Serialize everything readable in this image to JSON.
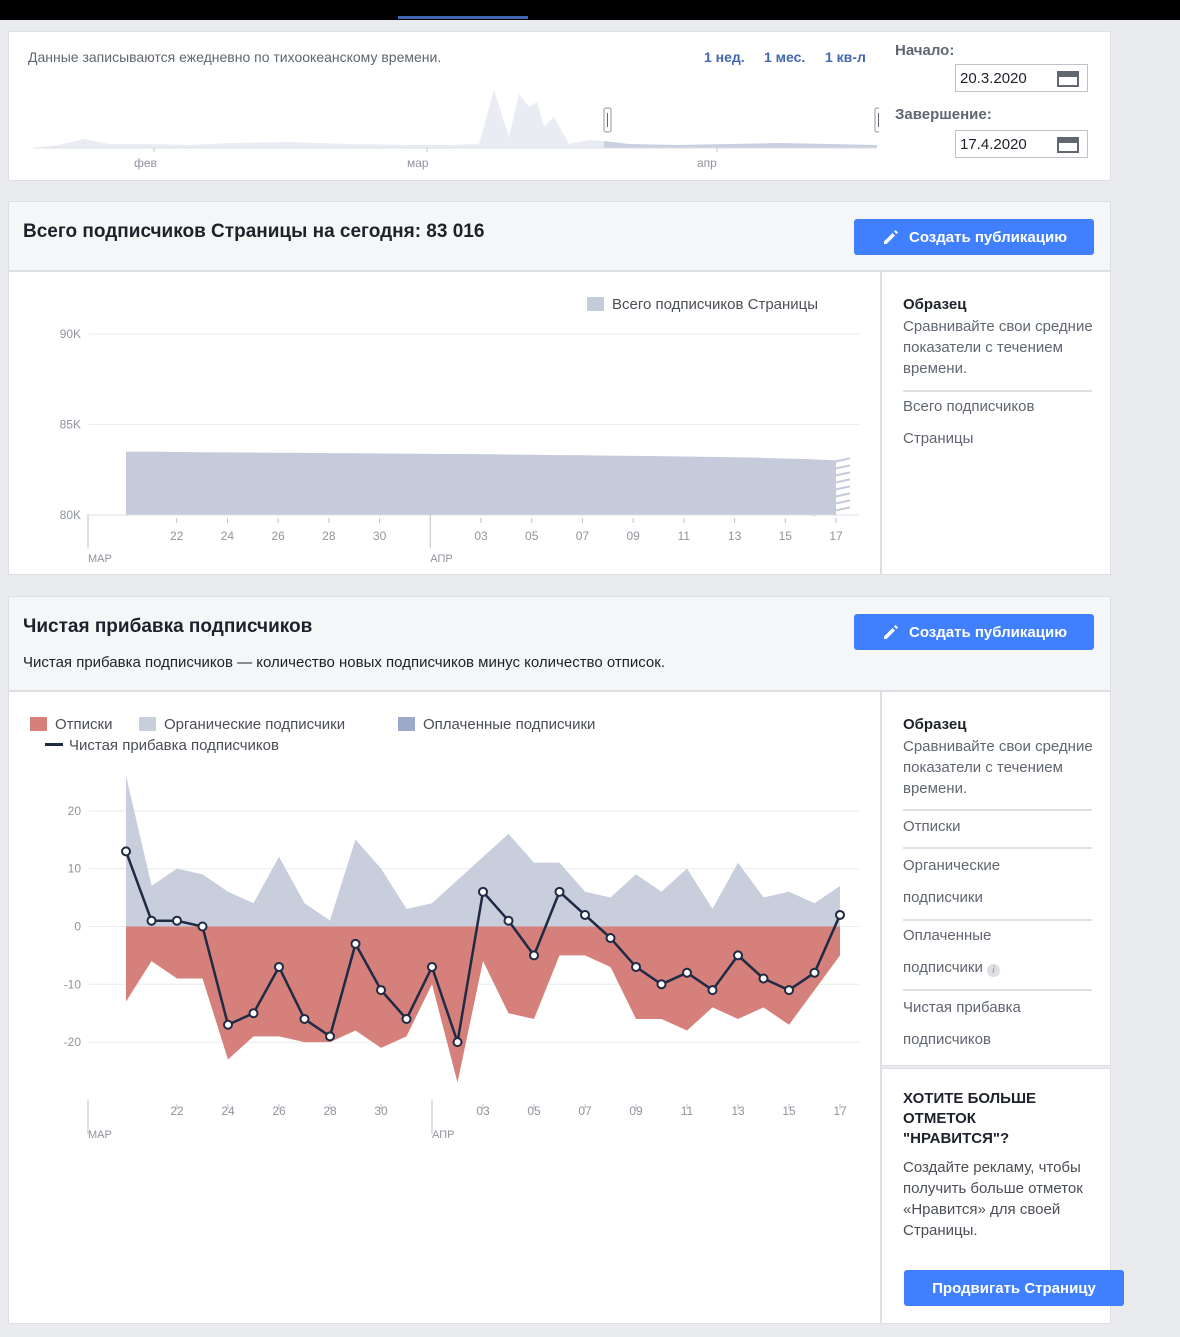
{
  "filter": {
    "note": "Данные записываются ежедневно по тихоокеанскому времени.",
    "ranges": [
      "1 нед.",
      "1 мес.",
      "1 кв-л"
    ],
    "months": [
      "фев",
      "мар",
      "апр"
    ],
    "start_label": "Начало:",
    "start_value": "20.3.2020",
    "end_label": "Завершение:",
    "end_value": "17.4.2020"
  },
  "followers": {
    "title": "Всего подписчиков Страницы на сегодня: 83 016",
    "create_button": "Создать публикацию",
    "legend": "Всего подписчиков Страницы",
    "side_title": "Образец",
    "side_text": "Сравнивайте свои средние показатели с течением времени.",
    "side_metrics": [
      "Всего подписчиков",
      "Страницы"
    ]
  },
  "net": {
    "title": "Чистая прибавка подписчиков",
    "subtitle": "Чистая прибавка подписчиков — количество новых подписчиков минус количество отписок.",
    "create_button": "Создать публикацию",
    "legend": [
      "Отписки",
      "Органические подписчики",
      "Оплаченные подписчики",
      "Чистая прибавка подписчиков"
    ],
    "side_title": "Образец",
    "side_text": "Сравнивайте свои средние показатели с течением времени.",
    "side_metrics": [
      "Отписки",
      "Органические",
      "подписчики",
      "Оплаченные",
      "подписчики",
      "Чистая прибавка",
      "подписчиков"
    ],
    "promo_title": "ХОТИТЕ БОЛЬШЕ ОТМЕТОК \"НРАВИТСЯ\"?",
    "promo_text": "Создайте рекламу, чтобы получить больше отметок «Нравится» для своей Страницы.",
    "promo_button": "Продвигать Страницу"
  },
  "colors": {
    "accent": "#4080ff",
    "link": "#4267b2",
    "followers_fill": "#c5cbda",
    "organic": "#c8cedc",
    "paid": "#9ea8c9",
    "unfollows": "#d5807b",
    "net_line": "#1f2a44"
  },
  "chart_data": [
    {
      "type": "area",
      "title": "",
      "x": [
        "20.3",
        "21.3",
        "22.3",
        "23.3",
        "24.3",
        "25.3",
        "26.3",
        "27.3",
        "28.3",
        "29.3",
        "30.3",
        "31.3",
        "01.4",
        "02.4",
        "03.4",
        "04.4",
        "05.4",
        "06.4",
        "07.4",
        "08.4",
        "09.4",
        "10.4",
        "11.4",
        "12.4",
        "13.4",
        "14.4",
        "15.4",
        "16.4",
        "17.4"
      ],
      "x_ticks": [
        "22",
        "24",
        "26",
        "28",
        "30",
        "03",
        "05",
        "07",
        "09",
        "11",
        "13",
        "15",
        "17"
      ],
      "x_month_labels": [
        "МАР",
        "АПР"
      ],
      "y_ticks": [
        "80K",
        "85K",
        "90K"
      ],
      "ylim": [
        80000,
        90000
      ],
      "series": [
        {
          "name": "Всего подписчиков Страницы",
          "values": [
            83500,
            83500,
            83480,
            83470,
            83460,
            83450,
            83440,
            83430,
            83420,
            83410,
            83400,
            83390,
            83380,
            83370,
            83360,
            83340,
            83330,
            83310,
            83300,
            83280,
            83270,
            83250,
            83230,
            83210,
            83190,
            83160,
            83120,
            83080,
            83016
          ]
        }
      ],
      "legend": "top-right",
      "grid": true
    },
    {
      "type": "area",
      "title": "",
      "x": [
        "20.3",
        "21.3",
        "22.3",
        "23.3",
        "24.3",
        "25.3",
        "26.3",
        "27.3",
        "28.3",
        "29.3",
        "30.3",
        "31.3",
        "01.4",
        "02.4",
        "03.4",
        "04.4",
        "05.4",
        "06.4",
        "07.4",
        "08.4",
        "09.4",
        "10.4",
        "11.4",
        "12.4",
        "13.4",
        "14.4",
        "15.4",
        "16.4",
        "17.4"
      ],
      "x_ticks": [
        "22",
        "24",
        "26",
        "28",
        "30",
        "03",
        "05",
        "07",
        "09",
        "11",
        "13",
        "15",
        "17"
      ],
      "x_month_labels": [
        "МАР",
        "АПР"
      ],
      "y_ticks": [
        "-20",
        "-10",
        "0",
        "10",
        "20"
      ],
      "ylim": [
        -28,
        28
      ],
      "series": [
        {
          "name": "Органические подписчики",
          "values": [
            26,
            7,
            10,
            9,
            6,
            4,
            12,
            4,
            1,
            15,
            10,
            3,
            4,
            8,
            12,
            16,
            11,
            11,
            6,
            5,
            9,
            6,
            10,
            3,
            11,
            5,
            6,
            4,
            7
          ]
        },
        {
          "name": "Оплаченные подписчики",
          "values": [
            0,
            0,
            0,
            0,
            0,
            0,
            0,
            0,
            0,
            0,
            0,
            0,
            0,
            0,
            0,
            0,
            0,
            0,
            0,
            0,
            0,
            0,
            0,
            0,
            0,
            0,
            0,
            0,
            0
          ]
        },
        {
          "name": "Отписки",
          "values": [
            -13,
            -6,
            -9,
            -9,
            -23,
            -19,
            -19,
            -20,
            -20,
            -18,
            -21,
            -19,
            -10,
            -27,
            -6,
            -15,
            -16,
            -5,
            -5,
            -7,
            -16,
            -16,
            -18,
            -14,
            -16,
            -14,
            -17,
            -11,
            -5
          ]
        },
        {
          "name": "Чистая прибавка подписчиков",
          "values": [
            13,
            1,
            1,
            0,
            -17,
            -15,
            -7,
            -16,
            -19,
            -3,
            -11,
            -16,
            -7,
            -20,
            6,
            1,
            -5,
            6,
            2,
            -2,
            -7,
            -10,
            -8,
            -11,
            -5,
            -9,
            -11,
            -8,
            2
          ]
        }
      ],
      "legend": "top-left",
      "grid": true
    }
  ]
}
